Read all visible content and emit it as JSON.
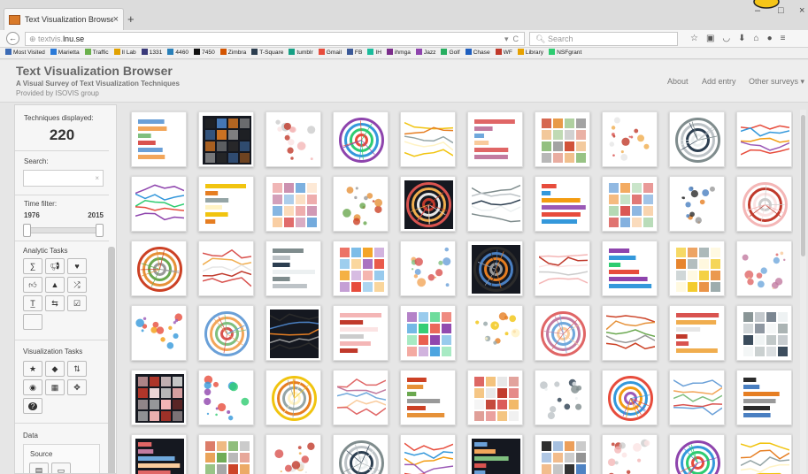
{
  "browser": {
    "tab_title": "Text Visualization Browser",
    "tab_close": "×",
    "new_tab": "+",
    "url_host": "textvis.",
    "url_domain": "lnu.se",
    "search_placeholder": "Search",
    "window_minimize": "–",
    "window_maximize": "□",
    "window_close": "×",
    "back": "←",
    "bookmarks": [
      "Most Visited",
      "Marietta",
      "Traffic",
      "Il Lab",
      "1331",
      "4460",
      "7450",
      "Zimbra",
      "T-Square",
      "tumblr",
      "Gmail",
      "FB",
      "IH",
      "ihmga",
      "Jazz",
      "Golf",
      "Chase",
      "WF",
      "Library",
      "NSFgrant"
    ]
  },
  "site": {
    "title": "Text Visualization Browser",
    "subtitle": "A Visual Survey of Text Visualization Techniques",
    "provided": "Provided by ISOVIS group",
    "nav": [
      "About",
      "Add entry",
      "Other surveys ▾"
    ]
  },
  "sidebar": {
    "techniques_label": "Techniques displayed:",
    "techniques_count": "220",
    "search_label": "Search:",
    "search_clear": "×",
    "time_filter_label": "Time filter:",
    "time_start": "1976",
    "time_end": "2015",
    "analytic_tasks_label": "Analytic Tasks",
    "analytic_icons": [
      "sigma-icon",
      "megaphone-icon",
      "heart-icon",
      "thumbs-up-icon",
      "warning-icon",
      "shuffle-icon",
      "text-underline-icon",
      "retweet-icon",
      "checkbox-icon",
      "blank-icon"
    ],
    "visualization_tasks_label": "Visualization Tasks",
    "visualization_icons": [
      "star-icon",
      "tag-icon",
      "sort-icon",
      "eye-icon",
      "network-icon",
      "move-icon",
      "question-icon"
    ],
    "data_label": "Data",
    "source_label": "Source",
    "source_icons": [
      "document-icon",
      "folder-icon"
    ]
  },
  "gallery": {
    "rows": 6,
    "cols": 10,
    "palettes": [
      [
        "#6aa0d8",
        "#f2a65a",
        "#7fbf7f",
        "#d9534f"
      ],
      [
        "#2b2b2b",
        "#4a7fc1",
        "#e67e22",
        "#999"
      ],
      [
        "#f4b6b6",
        "#c0392b",
        "#fbe3e3",
        "#ccc"
      ],
      [
        "#8e44ad",
        "#3498db",
        "#2ecc71",
        "#e74c3c"
      ],
      [
        "#f1c40f",
        "#e67e22",
        "#95a5a6",
        "#fff3c4"
      ],
      [
        "#e06666",
        "#c27ba0",
        "#6fa8dc",
        "#f9cb9c"
      ],
      [
        "#cc4125",
        "#e69138",
        "#6aa84f",
        "#999"
      ],
      [
        "#d9534f",
        "#f0ad4e",
        "#e6e6e6",
        "#c0392b"
      ],
      [
        "#7f8c8d",
        "#bdc3c7",
        "#2c3e50",
        "#ecf0f1"
      ],
      [
        "#e74c3c",
        "#3498db",
        "#f39c12",
        "#9b59b6"
      ]
    ]
  }
}
